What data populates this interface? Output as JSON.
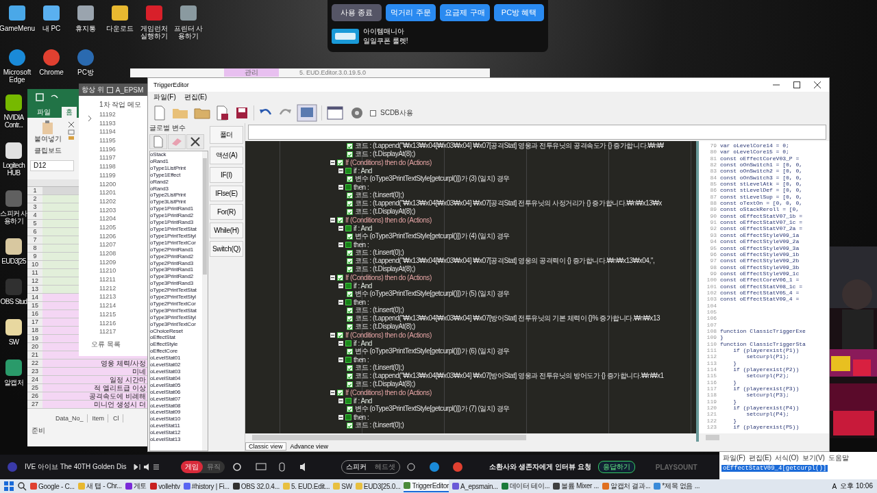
{
  "desktop_icons_top": [
    {
      "label": "GameMenu",
      "color": "#4aa8e8"
    },
    {
      "label": "내 PC",
      "color": "#5ab0f0"
    },
    {
      "label": "휴지통",
      "color": "#9aa4ae"
    },
    {
      "label": "다운로드",
      "color": "#e8b830"
    },
    {
      "label": "게임런처 실행하기",
      "color": "#d8202a"
    },
    {
      "label": "프린터 사용하기",
      "color": "#8a9aa0"
    }
  ],
  "desktop_icons_second": [
    {
      "label": "Microsoft Edge",
      "color": "#1a8ad8"
    },
    {
      "label": "Chrome",
      "color": "#e04030"
    },
    {
      "label": "PC방",
      "color": "#2a6ab0"
    }
  ],
  "desktop_icons_left": [
    {
      "label": "NVIDIA Contr...",
      "color": "#76b900"
    },
    {
      "label": "Logitech HUB",
      "color": "#e0e0e0"
    },
    {
      "label": "스피커 사용하기",
      "color": "#606060"
    },
    {
      "label": "EUD3[25",
      "color": "#d8c8a0"
    },
    {
      "label": "OBS Stud",
      "color": "#303030"
    },
    {
      "label": "SW",
      "color": "#e8d8a0"
    },
    {
      "label": "알캡처",
      "color": "#2a9a6a"
    }
  ],
  "pc_panel": {
    "buttons": [
      {
        "label": "사용 종료",
        "kind": "secondary"
      },
      {
        "label": "먹거리 주문",
        "kind": "primary"
      },
      {
        "label": "요금제 구매",
        "kind": "primary"
      },
      {
        "label": "PC방 혜택",
        "kind": "primary"
      }
    ],
    "banner": {
      "title": "아이템매니아",
      "subtitle": "일일쿠폰 룰렛!"
    }
  },
  "eud_window": {
    "tab": "관리",
    "title": "5. EUD.Editor.3.0.19.5.0"
  },
  "excel": {
    "tabs": [
      {
        "label": "파일",
        "selected": false
      },
      {
        "label": "홈",
        "selected": true
      }
    ],
    "paste": "붙여넣기",
    "clipboard": "클립보드",
    "name_box": "D12",
    "rows": [
      {
        "num": "1",
        "color": "#d8d8d8"
      },
      {
        "num": "2",
        "color": "#e2efda"
      },
      {
        "num": "3",
        "color": "#e2efda"
      },
      {
        "num": "4",
        "color": "#e2efda"
      },
      {
        "num": "5",
        "color": "#e2efda"
      },
      {
        "num": "6",
        "color": "#e2efda"
      },
      {
        "num": "7",
        "color": "#e2efda"
      },
      {
        "num": "8",
        "color": "#e2efda"
      },
      {
        "num": "9",
        "color": "#e2efda"
      },
      {
        "num": "10",
        "color": "#e2efda"
      },
      {
        "num": "11",
        "color": "#e2efda"
      },
      {
        "num": "12",
        "color": "#e2efda"
      },
      {
        "num": "13",
        "color": "#e2efda"
      },
      {
        "num": "14",
        "color": "#f4d6f4"
      },
      {
        "num": "15",
        "color": "#f4d6f4"
      },
      {
        "num": "16",
        "color": "#f4d6f4"
      },
      {
        "num": "17",
        "color": "#f4d6f4"
      },
      {
        "num": "18",
        "color": "#f4d6f4"
      },
      {
        "num": "19",
        "color": "#f4d6f4"
      },
      {
        "num": "20",
        "color": "#f4d6f4"
      },
      {
        "num": "21",
        "color": "#f4d6f4"
      },
      {
        "num": "22",
        "color": "#f4d6f4",
        "text": "영웅 체력/사정"
      },
      {
        "num": "23",
        "color": "#f4d6f4",
        "text": "미네"
      },
      {
        "num": "24",
        "color": "#f4d6f4",
        "text": "일정 시간마"
      },
      {
        "num": "25",
        "color": "#f4d6f4",
        "text": "적 엘리트급 이상"
      },
      {
        "num": "26",
        "color": "#f4d6f4",
        "text": "공격속도에 비례해"
      },
      {
        "num": "27",
        "color": "#f4d6f4",
        "text": "미니언 생성시 더"
      }
    ],
    "sheet_tabs": [
      "Data_No_",
      "Item",
      "Cl"
    ],
    "status": "준비"
  },
  "memo": {
    "always_on_top": "항상 위",
    "always_on_top_checked": false,
    "title": "A_EPSM",
    "tab": "1차 작업 메모",
    "line_numbers": [
      "11192",
      "11193",
      "11194",
      "11195",
      "11196",
      "11197",
      "11198",
      "11199",
      "11200",
      "11201",
      "11202",
      "11203",
      "11204",
      "11205",
      "11206",
      "11207",
      "11208",
      "11209",
      "11210",
      "11211",
      "11212",
      "11213",
      "11214",
      "11215",
      "11216",
      "11217"
    ],
    "errors": "오류 목록"
  },
  "trigger_editor": {
    "title": "TriggerEditor",
    "menu": [
      "파일(F)",
      "편집(E)"
    ],
    "scdb": {
      "label": "SCDB사용",
      "checked": false
    },
    "variables_label": "글로벌 변수",
    "variables": [
      "oStack",
      "oRand1",
      "oType1ListPrint",
      "oType1Effect",
      "oRand2",
      "oRand3",
      "oType2ListPrint",
      "oType3ListPrint",
      "oType1PrintRand1",
      "oType1PrintRand2",
      "oType1PrintRand3",
      "oType1PrintTextStat",
      "oType1PrintTextStyl",
      "oType1PrintTextCor",
      "oType2PrintRand1",
      "oType2PrintRand2",
      "oType2PrintRand3",
      "oType3PrintRand1",
      "oType3PrintRand2",
      "oType3PrintRand3",
      "oType2PrintTextStat",
      "oType2PrintTextStyl",
      "oType2PrintTextCor",
      "oType3PrintTextStat",
      "oType3PrintTextStyl",
      "oType3PrintTextCor",
      "oChoiceReset",
      "oEffectStat",
      "oEffectStyle",
      "oEffectCore",
      "oLevelStat01",
      "oLevelStat02",
      "oLevelStat03",
      "oLevelStat04",
      "oLevelStat05",
      "oLevelStat06",
      "oLevelStat07",
      "oLevelStat08",
      "oLevelStat09",
      "oLevelStat10",
      "oLevelStat11",
      "oLevelStat12",
      "oLevelStat13"
    ],
    "side_buttons": [
      "폴더",
      "액션(A)",
      "IF(I)",
      "IFlse(E)",
      "For(R)",
      "While(H)",
      "Switch(Q)"
    ],
    "tree": {
      "continued": [
        {
          "text": "코드 : (t.append(\"₩x13₩x04[₩x03₩x04] ₩x07[공격Stat] 영웅과 전투유닛의 공격속도가 {} 증가합니다.₩n₩",
          "checked": true
        },
        {
          "text": "코드 : (t.DisplayAt(8);)",
          "checked": true
        }
      ],
      "blocks": [
        {
          "label": "If (Conditions) then do (Actions)",
          "checked": true,
          "expanded": true,
          "children": [
            {
              "kind": "if",
              "label": "if :  And",
              "expanded": true,
              "children": [
                {
                  "text": "변수 (oType3PrintTextStyle[getcurpl()])가 (3) (일치) 경우",
                  "checked": true
                }
              ]
            },
            {
              "kind": "then",
              "label": "then :",
              "expanded": true,
              "children": [
                {
                  "text": "코드 : (t.insert(0);)",
                  "checked": true
                },
                {
                  "text": "코드 : (t.append(\"₩x13₩x04[₩x03₩x04] ₩x07[공격Stat] 전투유닛의 사정거리가 {} 증가합니다.₩n₩x13₩x",
                  "checked": true
                },
                {
                  "text": "코드 : (t.DisplayAt(8);)",
                  "checked": true
                }
              ]
            }
          ]
        },
        {
          "label": "If (Conditions) then do (Actions)",
          "checked": true,
          "expanded": true,
          "children": [
            {
              "kind": "if",
              "label": "if :  And",
              "expanded": true,
              "children": [
                {
                  "text": "변수 (oType3PrintTextStyle[getcurpl()])가 (4) (일치) 경우",
                  "checked": true
                }
              ]
            },
            {
              "kind": "then",
              "label": "then :",
              "expanded": true,
              "children": [
                {
                  "text": "코드 : (t.insert(0);)",
                  "checked": true
                },
                {
                  "text": "코드 : (t.append(\"₩x13₩x04[₩x03₩x04] ₩x07[공격Stat] 영웅의 공격력이 {} 증가합니다.₩n₩x13₩x04,\",",
                  "checked": true
                },
                {
                  "text": "코드 : (t.DisplayAt(8);)",
                  "checked": true
                }
              ]
            }
          ]
        },
        {
          "label": "If (Conditions) then do (Actions)",
          "checked": true,
          "expanded": true,
          "children": [
            {
              "kind": "if",
              "label": "if :  And",
              "expanded": true,
              "children": [
                {
                  "text": "변수 (oType3PrintTextStyle[getcurpl()])가 (5) (일치) 경우",
                  "checked": true
                }
              ]
            },
            {
              "kind": "then",
              "label": "then :",
              "expanded": true,
              "children": [
                {
                  "text": "코드 : (t.insert(0);)",
                  "checked": true
                },
                {
                  "text": "코드 : (t.append(\"₩x13₩x04[₩x03₩x04] ₩x07[방어Stat] 전투유닛의 기본 체력이 {}% 증가합니다.₩n₩x13",
                  "checked": true
                },
                {
                  "text": "코드 : (t.DisplayAt(8);)",
                  "checked": true
                }
              ]
            }
          ]
        },
        {
          "label": "If (Conditions) then do (Actions)",
          "checked": true,
          "expanded": true,
          "children": [
            {
              "kind": "if",
              "label": "if :  And",
              "expanded": true,
              "children": [
                {
                  "text": "변수 (oType3PrintTextStyle[getcurpl()])가 (6) (일치) 경우",
                  "checked": true
                }
              ]
            },
            {
              "kind": "then",
              "label": "then :",
              "expanded": true,
              "children": [
                {
                  "text": "코드 : (t.insert(0);)",
                  "checked": true
                },
                {
                  "text": "코드 : (t.append(\"₩x13₩x04[₩x03₩x04] ₩x07[방어Stat] 영웅과 전투유닛의 방어도가 {} 증가합니다.₩n₩x1",
                  "checked": true
                },
                {
                  "text": "코드 : (t.DisplayAt(8);)",
                  "checked": true
                }
              ]
            }
          ]
        },
        {
          "label": "If (Conditions) then do (Actions)",
          "checked": true,
          "expanded": true,
          "children": [
            {
              "kind": "if",
              "label": "if :  And",
              "expanded": true,
              "children": [
                {
                  "text": "변수 (oType3PrintTextStyle[getcurpl()])가 (7) (일치) 경우",
                  "checked": true
                }
              ]
            },
            {
              "kind": "then",
              "label": "then :",
              "expanded": true,
              "children": [
                {
                  "text": "코드 : (t.insert(0);)",
                  "checked": true
                }
              ]
            }
          ]
        }
      ]
    },
    "code_lines": [
      {
        "num": "79",
        "text": "var oLevelCore14 = 0;"
      },
      {
        "num": "80",
        "text": "var oLevelCore15 = 0;"
      },
      {
        "num": "81",
        "text": "const oEffectCoreV03_P ="
      },
      {
        "num": "82",
        "text": "const oOnSwitch1 = [0, 0,"
      },
      {
        "num": "83",
        "text": "const oOnSwitch2 = [0, 0,"
      },
      {
        "num": "84",
        "text": "const oOnSwitch3 = [0, 0,"
      },
      {
        "num": "85",
        "text": "const stLevelAtk = [0, 0,"
      },
      {
        "num": "86",
        "text": "const stLevelDef = [0, 0,"
      },
      {
        "num": "87",
        "text": "const stLevelSup = [0, 0,"
      },
      {
        "num": "88",
        "text": "const oTextOn = [0, 0, 0,"
      },
      {
        "num": "89",
        "text": "const oStackReroll = [0,"
      },
      {
        "num": "90",
        "text": "const oEffectStatV07_1b ="
      },
      {
        "num": "91",
        "text": "const oEffectStatV07_1c ="
      },
      {
        "num": "92",
        "text": "const oEffectStatV07_2a ="
      },
      {
        "num": "93",
        "text": "const oEffectStyleV09_1a"
      },
      {
        "num": "94",
        "text": "const oEffectStyleV09_2a"
      },
      {
        "num": "95",
        "text": "const oEffectStyleV09_3a"
      },
      {
        "num": "96",
        "text": "const oEffectStyleV09_1b"
      },
      {
        "num": "97",
        "text": "const oEffectStyleV09_2b"
      },
      {
        "num": "98",
        "text": "const oEffectStyleV09_3b"
      },
      {
        "num": "99",
        "text": "const oEffectStyleV09_1c"
      },
      {
        "num": "100",
        "text": "const oEffectCoreV06_1 ="
      },
      {
        "num": "101",
        "text": "const oEffectStatV08_1c ="
      },
      {
        "num": "102",
        "text": "const oEffectStatV05_4 ="
      },
      {
        "num": "103",
        "text": "const oEffectStatV09_4 ="
      },
      {
        "num": "104"
      },
      {
        "num": "105"
      },
      {
        "num": "106"
      },
      {
        "num": "107"
      },
      {
        "num": "108",
        "text": "function ClassicTriggerExe"
      },
      {
        "num": "109",
        "text": "}"
      },
      {
        "num": "110",
        "text": "function ClassicTriggerSta"
      },
      {
        "num": "111",
        "text": "    if (playerexist(P1))"
      },
      {
        "num": "112",
        "text": "        setcurpl(P1);"
      },
      {
        "num": "113",
        "text": "    }"
      },
      {
        "num": "114",
        "text": "    if (playerexist(P2))"
      },
      {
        "num": "115",
        "text": "        setcurpl(P2);"
      },
      {
        "num": "116",
        "text": "    }"
      },
      {
        "num": "117",
        "text": "    if (playerexist(P3))"
      },
      {
        "num": "118",
        "text": "        setcurpl(P3);"
      },
      {
        "num": "119",
        "text": "    }"
      },
      {
        "num": "120",
        "text": "    if (playerexist(P4))"
      },
      {
        "num": "121",
        "text": "        setcurpl(P4);"
      },
      {
        "num": "122",
        "text": "    }"
      },
      {
        "num": "123",
        "text": "    if (playerexist(P5))"
      }
    ],
    "view_tabs": [
      {
        "label": "Classic view",
        "selected": true
      },
      {
        "label": "Advance view",
        "selected": false
      }
    ]
  },
  "media_bar": {
    "song": "IVE 아이브 The 40TH Golden Dis",
    "modes": [
      {
        "label": "게임",
        "selected": true
      },
      {
        "label": "뮤직",
        "selected": false
      }
    ],
    "outputs": [
      {
        "label": "스피커",
        "selected": true
      },
      {
        "label": "헤드셋",
        "selected": false
      }
    ],
    "notice": "소환사와 생존자에게 인터뷰 요청",
    "reply": "응답하기",
    "brand": "PLAYSOUNT"
  },
  "notepad": {
    "menu": [
      "파일(F)",
      "편집(E)",
      "서식(O)",
      "보기(V)",
      "도움말"
    ],
    "selection": "oEffectStatV09_4[getcurpl()]"
  },
  "taskbar": {
    "items": [
      {
        "label": "Google - C...",
        "selected": false,
        "color": "#e04030"
      },
      {
        "label": "새 탭 - Chr...",
        "selected": false,
        "color": "#e8b830"
      },
      {
        "label": "게토",
        "selected": false,
        "color": "#7a2ad8"
      },
      {
        "label": "vollehtv",
        "selected": false,
        "color": "#c82020"
      },
      {
        "label": "#history | Fi...",
        "selected": false,
        "color": "#5865f2"
      },
      {
        "label": "OBS 32.0.4...",
        "selected": false,
        "color": "#303030"
      },
      {
        "label": "5. EUD.Edit...",
        "selected": false,
        "color": "#e8c040"
      },
      {
        "label": "SW",
        "selected": false,
        "color": "#e8c040"
      },
      {
        "label": "EUD3[25.0...",
        "selected": false,
        "color": "#e8c040"
      },
      {
        "label": "TriggerEditor",
        "selected": true,
        "color": "#4a8a3a"
      },
      {
        "label": "A_epsmain...",
        "selected": false,
        "color": "#6a5ad8"
      },
      {
        "label": "데이터 테이...",
        "selected": false,
        "color": "#1a7a3a"
      },
      {
        "label": "볼륨 Mixer ...",
        "selected": false,
        "color": "#404040"
      },
      {
        "label": "알캡처 결과...",
        "selected": false,
        "color": "#e07020"
      },
      {
        "label": "*제목 없음 ...",
        "selected": false,
        "color": "#3a8ad8"
      }
    ],
    "ime": "A",
    "time": "오후 10:06"
  }
}
